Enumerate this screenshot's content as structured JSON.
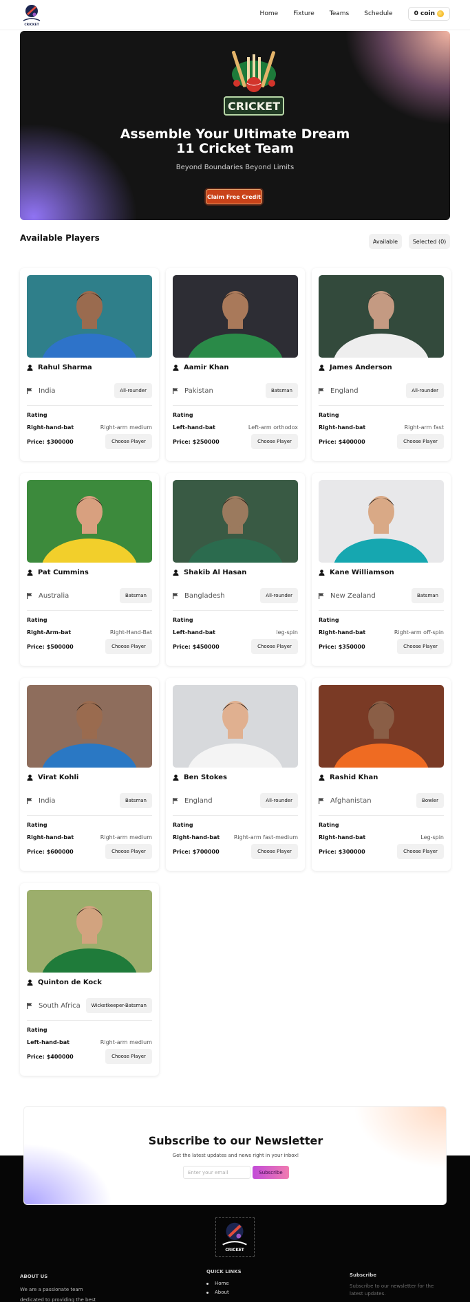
{
  "nav": {
    "logo_text": "CRICKET",
    "links": [
      "Home",
      "Fixture",
      "Teams",
      "Schedule"
    ],
    "coin_label": "0 coin"
  },
  "hero": {
    "badge_text": "CRICKET",
    "title_line1": "Assemble Your Ultimate Dream",
    "title_line2": "11 Cricket Team",
    "subtitle": "Beyond Boundaries Beyond Limits",
    "cta_label": "Claim Free Credit"
  },
  "players_section": {
    "title": "Available Players",
    "toggle_available": "Available",
    "toggle_selected": "Selected (0)"
  },
  "card_labels": {
    "rating": "Rating",
    "choose": "Choose Player"
  },
  "players": [
    {
      "name": "Rahul Sharma",
      "country": "India",
      "role": "All-rounder",
      "batting": "Right-hand-bat",
      "bowling": "Right-arm medium",
      "price": "Price: $300000"
    },
    {
      "name": "Aamir Khan",
      "country": "Pakistan",
      "role": "Batsman",
      "batting": "Left-hand-bat",
      "bowling": "Left-arm orthodox",
      "price": "Price: $250000"
    },
    {
      "name": "James Anderson",
      "country": "England",
      "role": "All-rounder",
      "batting": "Right-hand-bat",
      "bowling": "Right-arm fast",
      "price": "Price: $400000"
    },
    {
      "name": "Pat Cummins",
      "country": "Australia",
      "role": "Batsman",
      "batting": "Right-Arm-bat",
      "bowling": "Right-Hand-Bat",
      "price": "Price: $500000"
    },
    {
      "name": "Shakib Al Hasan",
      "country": "Bangladesh",
      "role": "All-rounder",
      "batting": "Left-hand-bat",
      "bowling": "leg-spin",
      "price": "Price: $450000"
    },
    {
      "name": "Kane Williamson",
      "country": "New Zealand",
      "role": "Batsman",
      "batting": "Right-hand-bat",
      "bowling": "Right-arm off-spin",
      "price": "Price: $350000"
    },
    {
      "name": "Virat Kohli",
      "country": "India",
      "role": "Batsman",
      "batting": "Right-hand-bat",
      "bowling": "Right-arm medium",
      "price": "Price: $600000"
    },
    {
      "name": "Ben Stokes",
      "country": "England",
      "role": "All-rounder",
      "batting": "Right-hand-bat",
      "bowling": "Right-arm fast-medium",
      "price": "Price: $700000"
    },
    {
      "name": "Rashid Khan",
      "country": "Afghanistan",
      "role": "Bowler",
      "batting": "Right-hand-bat",
      "bowling": "Leg-spin",
      "price": "Price: $300000"
    },
    {
      "name": "Quinton de Kock",
      "country": "South Africa",
      "role": "Wicketkeeper-Batsman",
      "batting": "Left-hand-bat",
      "bowling": "Right-arm medium",
      "price": "Price: $400000"
    }
  ],
  "newsletter": {
    "title": "Subscribe to our Newsletter",
    "subtitle": "Get the latest updates and news right in your inbox!",
    "placeholder": "Enter your email",
    "button": "Subscribe"
  },
  "footer": {
    "about_title": "ABOUT US",
    "about_text_1": "We are a passionate team",
    "about_text_2": "dedicated to providing the best",
    "links_title": "QUICK LINKS",
    "links": [
      "Home",
      "About"
    ],
    "subscribe_title": "Subscribe",
    "subscribe_text_1": "Subscribe to our newsletter for the",
    "subscribe_text_2": "latest updates."
  },
  "colors": {
    "cta": "#c9431a",
    "subscribe_gradient_start": "#c24bd8",
    "subscribe_gradient_end": "#f07bb0",
    "footer_bg": "#060606"
  }
}
